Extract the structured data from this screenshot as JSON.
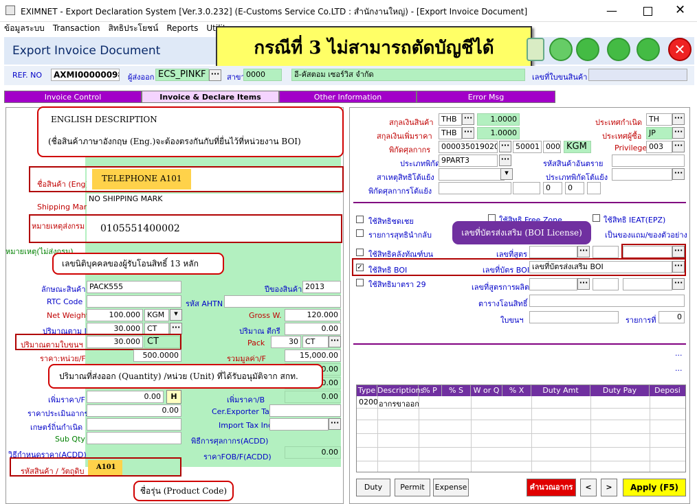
{
  "window": {
    "title": "EXIMNET - Export Declaration System [Ver.3.0.232] (E-Customs Service Co.LTD : สำนักงานใหญ่) - [Export Invoice Document]"
  },
  "menu": [
    "ข้อมูลระบบ",
    "Transaction",
    "สิทธิประโยชน์",
    "Reports",
    "Utility"
  ],
  "header": {
    "title": "Export Invoice Document",
    "banner": "กรณีที่ 3 ไม่สามารถตัดบัญชีได้"
  },
  "ref": {
    "ref_label": "REF. NO",
    "ref_value": "AXMI00000098",
    "exporter_label": "ผู้ส่งออก",
    "exporter_value": "ECS_PINKF",
    "branch_label": "สาขา",
    "branch_value": "0000",
    "company_value": "อี-คัสตอม เซอร์วิส จำกัด",
    "doc_label": "เลขที่ใบขนสินค้า"
  },
  "tabs": [
    "Invoice Control",
    "Invoice & Declare Items",
    "Other Information",
    "Error Msg"
  ],
  "left": {
    "eng_name_label": "ชื่อสินค้า (Eng)",
    "eng_name_value": "TELEPHONE A101",
    "shipping_mark_label": "Shipping Mark",
    "shipping_mark_value": "NO SHIPPING MARK",
    "remark_label": "หมายเหตุส่งกรม",
    "remark_value": "0105551400002",
    "remark2_label": "หมายเหตุ(ไม่ส่งกรม)",
    "nature_label": "ลักษณะสินค้า",
    "nature_value": "PACK555",
    "year_label": "ปีของสินค้า",
    "year_value": "2013",
    "rtc_label": "RTC Code",
    "ahtn_label": "รหัส AHTN",
    "net_label": "Net Weight",
    "net_value": "100.000",
    "net_unit": "KGM",
    "gross_label": "Gross W.",
    "gross_value": "120.000",
    "qty_inv_label": "ปริมาณตาม Inv.",
    "qty_inv_value": "30.000",
    "qty_inv_unit": "CT",
    "qty_tariff_label": "ปริมาณ ตีกรี",
    "qty_tariff_value": "0.00",
    "qty_decl_label": "ปริมาณตามใบขนฯ",
    "qty_decl_value": "30.000",
    "qty_decl_unit": "CT",
    "pack_label": "Pack",
    "pack_value": "30",
    "pack_unit": "CT",
    "price_label": "ราคา:หน่วย/F",
    "price_value": "500.0000",
    "total_label": "รวมมูลค่า/F",
    "total_value": "15,000.00",
    "v1": "0.00",
    "v2": "0.00",
    "add_f_label": "เพิ่มราคา/F",
    "add_f_value": "0.00",
    "h_btn": "H",
    "add_b_label": "เพิ่มราคา/B",
    "add_b_value": "0.00",
    "assess_label": "ราคาประเมินอากร",
    "assess_value": "0.00",
    "cer_label": "Cer.Exporter Tax",
    "origin_label": "เกษตร์ถิ่นกำเนิด",
    "import_tax_label": "Import Tax Inc",
    "subqty_label": "Sub Qty",
    "acdd_label": "พิธีการศุลกากร(ACDD)",
    "method_label": "วิธีกำหนดราคา(ACDD)",
    "fob_label": "ราคาFOB/F(ACDD)",
    "fob_value": "0.00",
    "product_code_label": "รหัสสินค้า / วัตถุดิบ",
    "product_code_value": "A101"
  },
  "right": {
    "currency_label": "สกุลเงินสินค้า",
    "currency_value": "THB",
    "rate1": "1.0000",
    "currency2_label": "สกุลเงินเพิ่มราคา",
    "currency2_value": "THB",
    "rate2": "1.0000",
    "tariff_label": "พิกัดศุลกากร",
    "tariff_value": "000035019020",
    "tariff2": "50001",
    "tariff3": "000",
    "tariff_unit": "KGM",
    "type_label": "ประเภทพิกัด",
    "type_value": "9PART3",
    "hazard_label": "สาเหตุสิทธิโต้แย้ง",
    "tariff_dispute_label": "พิกัดศุลกากรโต้แย้ง",
    "td1": "0",
    "td2": "0",
    "origin_label": "ประเทศกำเนิด",
    "origin_value": "TH",
    "buyer_label": "ประเทศผู้ซื้อ",
    "buyer_value": "JP",
    "privilege_label": "Privilege",
    "privilege_value": "003",
    "danger_label": "รหัสสินค้าอันตราย",
    "dispute_type_label": "ประเภทพิกัดโต้แย้ง",
    "opt1": "ใช้สิทธิชดเชย",
    "opt2": "รายการสุทธินำกลับ",
    "opt3": "ใช้สิทธิคลังทัณฑ์บน",
    "opt4": "ใช้สิทธิ BOI",
    "opt5": "ใช้สิทธิมาตรา 29",
    "free_zone": "ใช้สิทธิ Free Zone",
    "ieat": "ใช้สิทธิ IEAT(EPZ)",
    "sample": "เป็นของแถม/ของตัวอย่าง",
    "formula_no_label": "เลขที่สูตร",
    "boi_label": "เลขที่บัตร BOI",
    "boi_value": "เลขที่บัตรส่งเสริม BOI",
    "prod_formula_label": "เลขที่สูตรการผลิต",
    "transfer_label": "ตารางโอนสิทธิ์",
    "permit_label": "ใบขนฯ",
    "item_label": "รายการที่",
    "item_value": "0",
    "grid_headers": [
      "Type",
      "Descriptions",
      "% P",
      "% S",
      "W or Q",
      "% X",
      "Duty Amt",
      "Duty Pay",
      "Deposi"
    ],
    "grid_row": [
      "0200",
      "อากรขาออก"
    ],
    "buttons": {
      "duty": "Duty",
      "permit": "Permit",
      "expense": "Expense",
      "calc": "คำนวณอากร",
      "prev": "<",
      "next": ">",
      "apply": "Apply (F5)"
    }
  },
  "callouts": {
    "eng_title": "ENGLISH DESCRIPTION",
    "eng_desc": "(ชื่อสินค้าภาษาอังกฤษ (Eng.)จะต้องตรงกันกับที่ยื่นไว้ที่หน่วยงาน BOI)",
    "tax_id": "เลขนิติบุคคลของผู้รับโอนสิทธิ์ 13 หลัก",
    "boi_license": "เลขที่บัตรส่งเสริม (BOI License)",
    "quantity": "ปริมาณที่ส่งออก (Quantity) /หน่วย (Unit) ที่ได้รับอนุมัติจาก สกท.",
    "product_code": "ชื่อรุ่น (Product Code)"
  }
}
